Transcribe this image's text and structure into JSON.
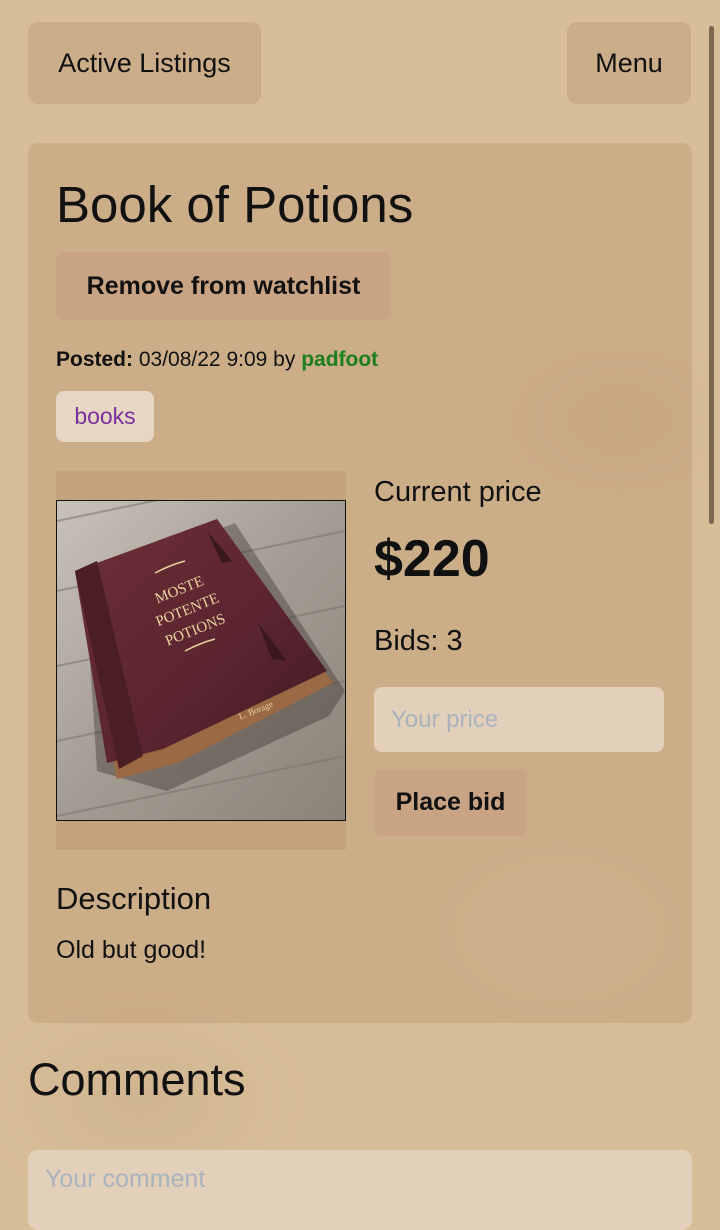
{
  "nav": {
    "active_listings": "Active Listings",
    "menu": "Menu"
  },
  "listing": {
    "title": "Book of Potions",
    "watch_button": "Remove from watchlist",
    "posted_label": "Posted:",
    "posted_date": "03/08/22 9:09",
    "by_text": "by",
    "author": "padfoot",
    "category": "books",
    "image": {
      "cover_lines": [
        "MOSTE",
        "POTENTE",
        "POTIONS"
      ],
      "author_mark": "L. Borage"
    },
    "current_price_label": "Current price",
    "current_price": "$220",
    "bids_text": "Bids: 3",
    "bid_placeholder": "Your price",
    "bid_button": "Place bid",
    "description_heading": "Description",
    "description": "Old but good!"
  },
  "comments": {
    "heading": "Comments",
    "placeholder": "Your comment"
  },
  "colors": {
    "page_background": "#d8bd99",
    "button": "#c9a484",
    "author_link": "#1b7f1b",
    "category_text": "#7a2e9e"
  }
}
